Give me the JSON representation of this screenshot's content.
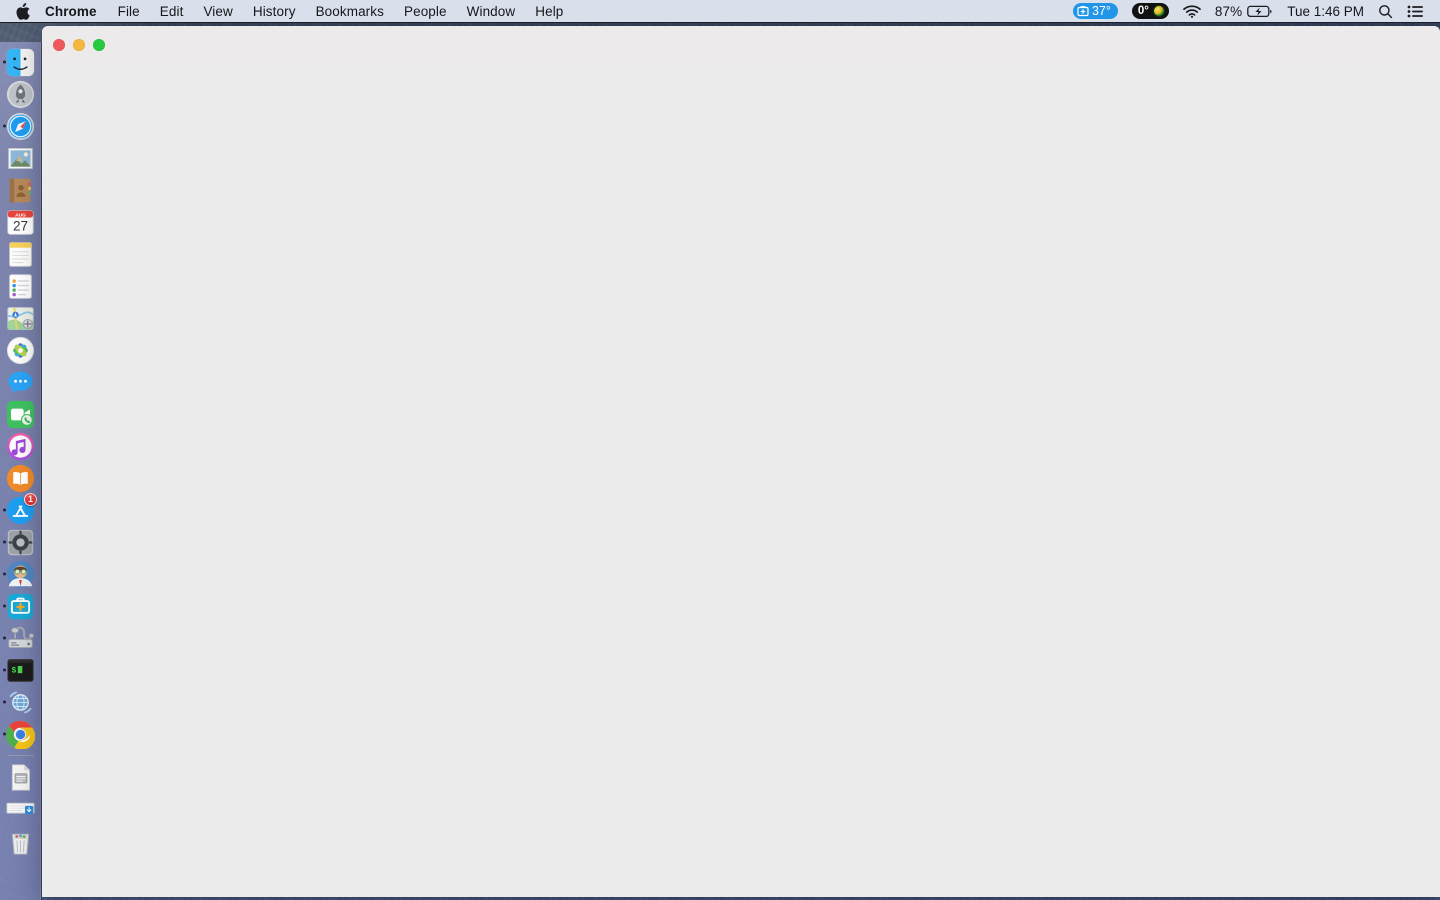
{
  "menubar": {
    "apple_icon": "apple-logo-icon",
    "app_name": "Chrome",
    "items": [
      {
        "label": "File"
      },
      {
        "label": "Edit"
      },
      {
        "label": "View"
      },
      {
        "label": "History"
      },
      {
        "label": "Bookmarks"
      },
      {
        "label": "People"
      },
      {
        "label": "Window"
      },
      {
        "label": "Help"
      }
    ],
    "status": {
      "weather": {
        "icon": "weather-widget-icon",
        "value": "37°",
        "color": "#2196e8"
      },
      "gauge": {
        "value": "0°",
        "icon": "dial-gauge-icon",
        "color": "#121212"
      },
      "wifi": {
        "icon": "wifi-icon"
      },
      "battery": {
        "percent": "87%",
        "icon": "battery-charging-icon"
      },
      "clock": "Tue 1:46 PM",
      "search": {
        "icon": "search-icon"
      },
      "control_center": {
        "icon": "control-center-icon"
      }
    }
  },
  "dock": {
    "items": [
      {
        "name": "finder",
        "label": "Finder",
        "running": true
      },
      {
        "name": "launchpad",
        "label": "Launchpad",
        "running": false
      },
      {
        "name": "safari",
        "label": "Safari",
        "running": true
      },
      {
        "name": "mail",
        "label": "Mail",
        "running": false
      },
      {
        "name": "contacts",
        "label": "Contacts",
        "running": false
      },
      {
        "name": "calendar",
        "label": "Calendar",
        "running": false,
        "month": "AUG",
        "day": "27"
      },
      {
        "name": "notes",
        "label": "Notes",
        "running": false
      },
      {
        "name": "reminders",
        "label": "Reminders",
        "running": false
      },
      {
        "name": "maps",
        "label": "Maps",
        "running": false
      },
      {
        "name": "photos",
        "label": "Photos",
        "running": false
      },
      {
        "name": "messages",
        "label": "Messages",
        "running": false
      },
      {
        "name": "facetime",
        "label": "FaceTime",
        "running": false
      },
      {
        "name": "itunes",
        "label": "iTunes",
        "running": false
      },
      {
        "name": "books",
        "label": "Books",
        "running": false
      },
      {
        "name": "app-store",
        "label": "App Store",
        "running": true,
        "badge": "1"
      },
      {
        "name": "system-preferences",
        "label": "System Preferences",
        "running": true
      },
      {
        "name": "user-avatar-app",
        "label": "Profile",
        "running": true
      },
      {
        "name": "first-aid",
        "label": "First Aid",
        "running": true
      },
      {
        "name": "disk-utility",
        "label": "Disk Utility",
        "running": true
      },
      {
        "name": "terminal",
        "label": "Terminal",
        "running": true
      },
      {
        "name": "network-utility",
        "label": "Network Utility",
        "running": true
      },
      {
        "name": "chrome",
        "label": "Google Chrome",
        "running": true
      }
    ],
    "stack_items": [
      {
        "name": "documents-stack",
        "label": "Documents"
      },
      {
        "name": "downloads-stack",
        "label": "Downloads"
      },
      {
        "name": "trash",
        "label": "Trash"
      }
    ]
  },
  "window": {
    "traffic_lights": {
      "close": "close-button",
      "minimize": "minimize-button",
      "maximize": "maximize-button"
    },
    "title": "",
    "body_text": ""
  },
  "colors": {
    "menubar_bg": "#d9dfeb",
    "window_bg": "#ececec",
    "titlebar_bg": "#eceaea",
    "accent_blue": "#2196e8",
    "close": "#f0575d",
    "minimize": "#f6b73e",
    "maximize": "#27c93f"
  }
}
